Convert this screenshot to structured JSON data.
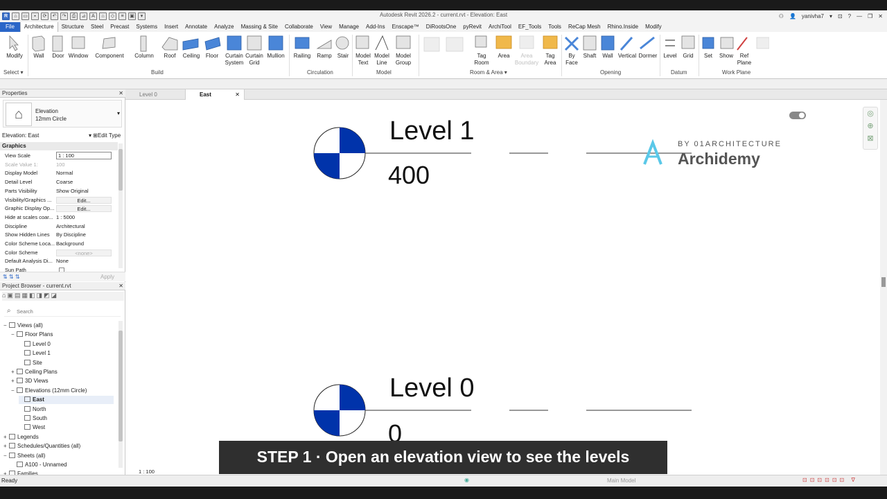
{
  "window": {
    "title": "Autodesk Revit 2026.2 - current.rvt - Elevation: East",
    "user": "yanivha7"
  },
  "menu": {
    "tabs": [
      "File",
      "Architecture",
      "Structure",
      "Steel",
      "Precast",
      "Systems",
      "Insert",
      "Annotate",
      "Analyze",
      "Massing & Site",
      "Collaborate",
      "View",
      "Manage",
      "Add-Ins",
      "Enscape™",
      "DiRootsOne",
      "pyRevit",
      "ArchiTool",
      "EF_Tools",
      "Tools",
      "ReCap Mesh",
      "Rhino.Inside",
      "Modify"
    ],
    "active": "Architecture"
  },
  "ribbon": {
    "select_label": "Select",
    "tools": {
      "modify": "Modify",
      "wall": "Wall",
      "door": "Door",
      "window": "Window",
      "component": "Component",
      "column": "Column",
      "roof": "Roof",
      "ceiling": "Ceiling",
      "floor": "Floor",
      "curtain_system": "Curtain System",
      "curtain_grid": "Curtain Grid",
      "mullion": "Mullion",
      "railing": "Railing",
      "ramp": "Ramp",
      "stair": "Stair",
      "model_text": "Model Text",
      "model_line": "Model Line",
      "model_group": "Model Group",
      "tag_room": "Tag Room",
      "area": "Area",
      "area_boundary": "Area Boundary",
      "tag_area": "Tag Area",
      "by_face": "By Face",
      "shaft": "Shaft",
      "wall_opening": "Wall",
      "vertical": "Vertical",
      "dormer": "Dormer",
      "level": "Level",
      "grid": "Grid",
      "set": "Set",
      "show": "Show",
      "ref_plane": "Ref Plane"
    },
    "panels": {
      "build": "Build",
      "circulation": "Circulation",
      "model": "Model",
      "room_area": "Room & Area",
      "opening": "Opening",
      "datum": "Datum",
      "work_plane": "Work Plane"
    }
  },
  "properties": {
    "header": "Properties",
    "family": "Elevation",
    "type": "12mm Circle",
    "instance": "Elevation: East",
    "edit_type": "Edit Type",
    "group": "Graphics",
    "rows": [
      {
        "k": "View Scale",
        "v": "1 : 100"
      },
      {
        "k": "Scale Value    1:",
        "v": "100"
      },
      {
        "k": "Display Model",
        "v": "Normal"
      },
      {
        "k": "Detail Level",
        "v": "Coarse"
      },
      {
        "k": "Parts Visibility",
        "v": "Show Original"
      },
      {
        "k": "Visibility/Graphics ...",
        "v": "Edit..."
      },
      {
        "k": "Graphic Display Op...",
        "v": "Edit..."
      },
      {
        "k": "Hide at scales coar...",
        "v": "1 : 5000"
      },
      {
        "k": "Discipline",
        "v": "Architectural"
      },
      {
        "k": "Show Hidden Lines",
        "v": "By Discipline"
      },
      {
        "k": "Color Scheme Loca...",
        "v": "Background"
      },
      {
        "k": "Color Scheme",
        "v": "<none>"
      },
      {
        "k": "Default Analysis Di...",
        "v": "None"
      },
      {
        "k": "Sun Path",
        "v": ""
      }
    ],
    "apply": "Apply"
  },
  "browser": {
    "header": "Project Browser - current.rvt",
    "search_placeholder": "Search",
    "items": [
      {
        "label": "Views (all)",
        "level": 0,
        "toggle": "−"
      },
      {
        "label": "Floor Plans",
        "level": 1,
        "toggle": "−"
      },
      {
        "label": "Level 0",
        "level": 2,
        "toggle": ""
      },
      {
        "label": "Level 1",
        "level": 2,
        "toggle": ""
      },
      {
        "label": "Site",
        "level": 2,
        "toggle": ""
      },
      {
        "label": "Ceiling Plans",
        "level": 1,
        "toggle": "+"
      },
      {
        "label": "3D Views",
        "level": 1,
        "toggle": "+"
      },
      {
        "label": "Elevations (12mm Circle)",
        "level": 1,
        "toggle": "−"
      },
      {
        "label": "East",
        "level": 2,
        "toggle": "",
        "selected": true
      },
      {
        "label": "North",
        "level": 2,
        "toggle": ""
      },
      {
        "label": "South",
        "level": 2,
        "toggle": ""
      },
      {
        "label": "West",
        "level": 2,
        "toggle": ""
      },
      {
        "label": "Legends",
        "level": 0,
        "toggle": "+"
      },
      {
        "label": "Schedules/Quantities (all)",
        "level": 0,
        "toggle": "+"
      },
      {
        "label": "Sheets (all)",
        "level": 0,
        "toggle": "−"
      },
      {
        "label": "A100 - Unnamed",
        "level": 1,
        "toggle": ""
      },
      {
        "label": "Families",
        "level": 0,
        "toggle": "+"
      }
    ]
  },
  "view_tabs": [
    {
      "label": "Level 0",
      "active": false
    },
    {
      "label": "East",
      "active": true
    }
  ],
  "levels": [
    {
      "name": "Level 1",
      "elevation": "400"
    },
    {
      "name": "Level 0",
      "elevation": "0"
    }
  ],
  "watermark": {
    "by": "BY 01ARCHITECTURE",
    "brand": "Archidemy"
  },
  "caption": "STEP 1  ·  Open an elevation view to see the levels",
  "status": {
    "left": "Ready",
    "scale": "1 : 100",
    "model": "Main Model"
  },
  "colors": {
    "accent": "#2a66c8",
    "level_head": "#0033aa"
  }
}
